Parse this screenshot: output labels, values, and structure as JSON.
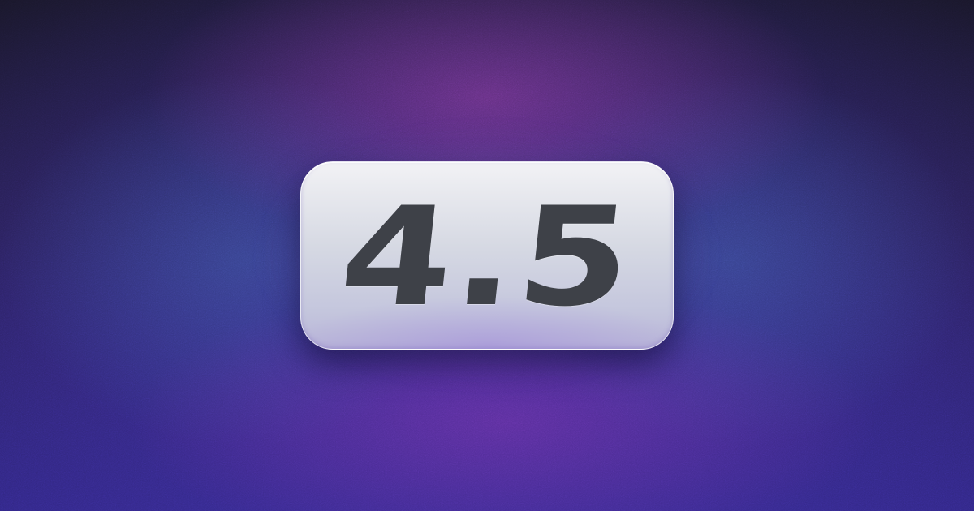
{
  "badge": {
    "version": "4.5"
  },
  "colors": {
    "background_top": "#181628",
    "background_bottom": "#2e2580",
    "glow_purple": "#963ca0",
    "glow_blue": "#3c64aa",
    "badge_light": "#f2f2f5",
    "badge_dark": "#b8b4d8",
    "text": "#3e4148"
  }
}
